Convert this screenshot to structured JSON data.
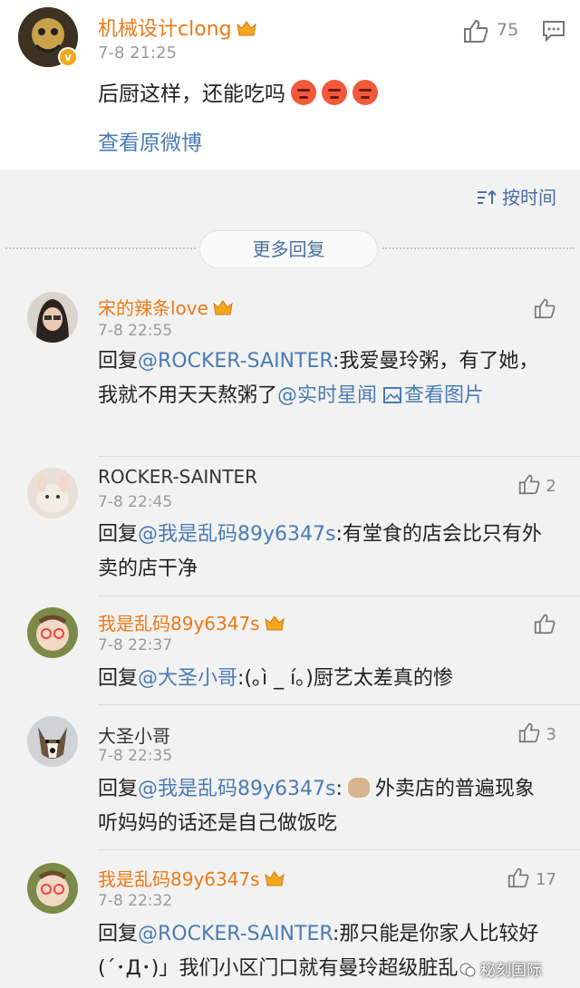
{
  "original_post": {
    "username": "机械设计clong",
    "time": "7-8 21:25",
    "text": "后厨这样，还能吃吗",
    "emoji": [
      "angry-face-icon",
      "angry-face-icon",
      "angry-face-icon"
    ],
    "view_original": "查看原微博",
    "like_count": "75"
  },
  "sort": {
    "label": "按时间"
  },
  "more_replies": {
    "label": "更多回复"
  },
  "comments": [
    {
      "username": "宋的辣条love",
      "vip": true,
      "time": "7-8 22:55",
      "reply_prefix": "回复",
      "mention": "@ROCKER-SAINTER",
      "text": ":我爱曼玲粥，有了她，我就不用天天熬粥了",
      "mention2": "@实时星闻",
      "link": "查看图片",
      "like_count": ""
    },
    {
      "username": "ROCKER-SAINTER",
      "vip": false,
      "time": "7-8 22:45",
      "reply_prefix": "回复",
      "mention": "@我是乱码89y6347s",
      "text": ":有堂食的店会比只有外卖的店干净",
      "like_count": "2"
    },
    {
      "username": "我是乱码89y6347s",
      "vip": true,
      "time": "7-8 22:37",
      "reply_prefix": "回复",
      "mention": "@大圣小哥",
      "text": ":(｡ì _ í｡)厨艺太差真的惨",
      "like_count": ""
    },
    {
      "username": "大圣小哥",
      "vip": false,
      "time": "7-8 22:35",
      "reply_prefix": "回复",
      "mention": "@我是乱码89y6347s",
      "text_a": ":",
      "text_b": "外卖店的普遍现象  听妈妈的话还是自己做饭吃",
      "like_count": "3"
    },
    {
      "username": "我是乱码89y6347s",
      "vip": true,
      "time": "7-8 22:32",
      "reply_prefix": "回复",
      "mention": "@ROCKER-SAINTER",
      "text": ":那只能是你家人比较好(´･Д･)」我们小区门口就有曼玲超级脏乱",
      "like_count": "17"
    }
  ],
  "watermark": "秘刻国际",
  "colors": {
    "vip_name": "#ec7a16",
    "link": "#4a7bb5",
    "background": "#f2f2f2"
  }
}
